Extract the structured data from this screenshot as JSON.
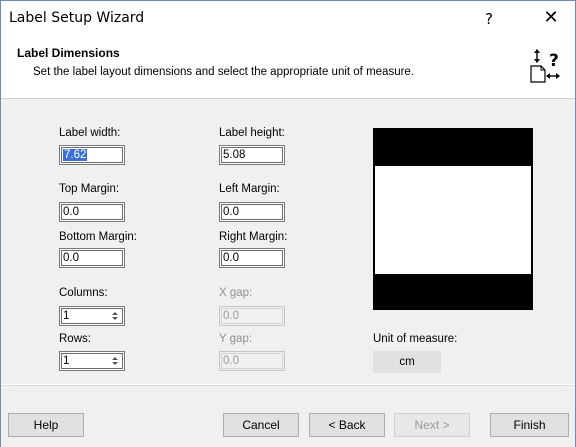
{
  "window": {
    "title": "Label Setup Wizard",
    "help_glyph": "?",
    "close_glyph": "✕"
  },
  "header": {
    "title": "Label Dimensions",
    "subtitle": "Set the label layout dimensions and select the appropriate unit of measure.",
    "icon": "label-dimensions-help-icon"
  },
  "form": {
    "label_width": {
      "label": "Label width:",
      "value": "7.62"
    },
    "label_height": {
      "label": "Label height:",
      "value": "5.08"
    },
    "top_margin": {
      "label": "Top Margin:",
      "value": "0.0"
    },
    "left_margin": {
      "label": "Left Margin:",
      "value": "0.0"
    },
    "bottom_margin": {
      "label": "Bottom Margin:",
      "value": "0.0"
    },
    "right_margin": {
      "label": "Right Margin:",
      "value": "0.0"
    },
    "columns": {
      "label": "Columns:",
      "value": "1"
    },
    "rows": {
      "label": "Rows:",
      "value": "1"
    },
    "x_gap": {
      "label": "X gap:",
      "value": "0.0"
    },
    "y_gap": {
      "label": "Y gap:",
      "value": "0.0"
    }
  },
  "unit": {
    "label": "Unit of measure:",
    "value": "cm"
  },
  "footer": {
    "help": "Help",
    "cancel": "Cancel",
    "back": "< Back",
    "next": "Next >",
    "finish": "Finish"
  }
}
